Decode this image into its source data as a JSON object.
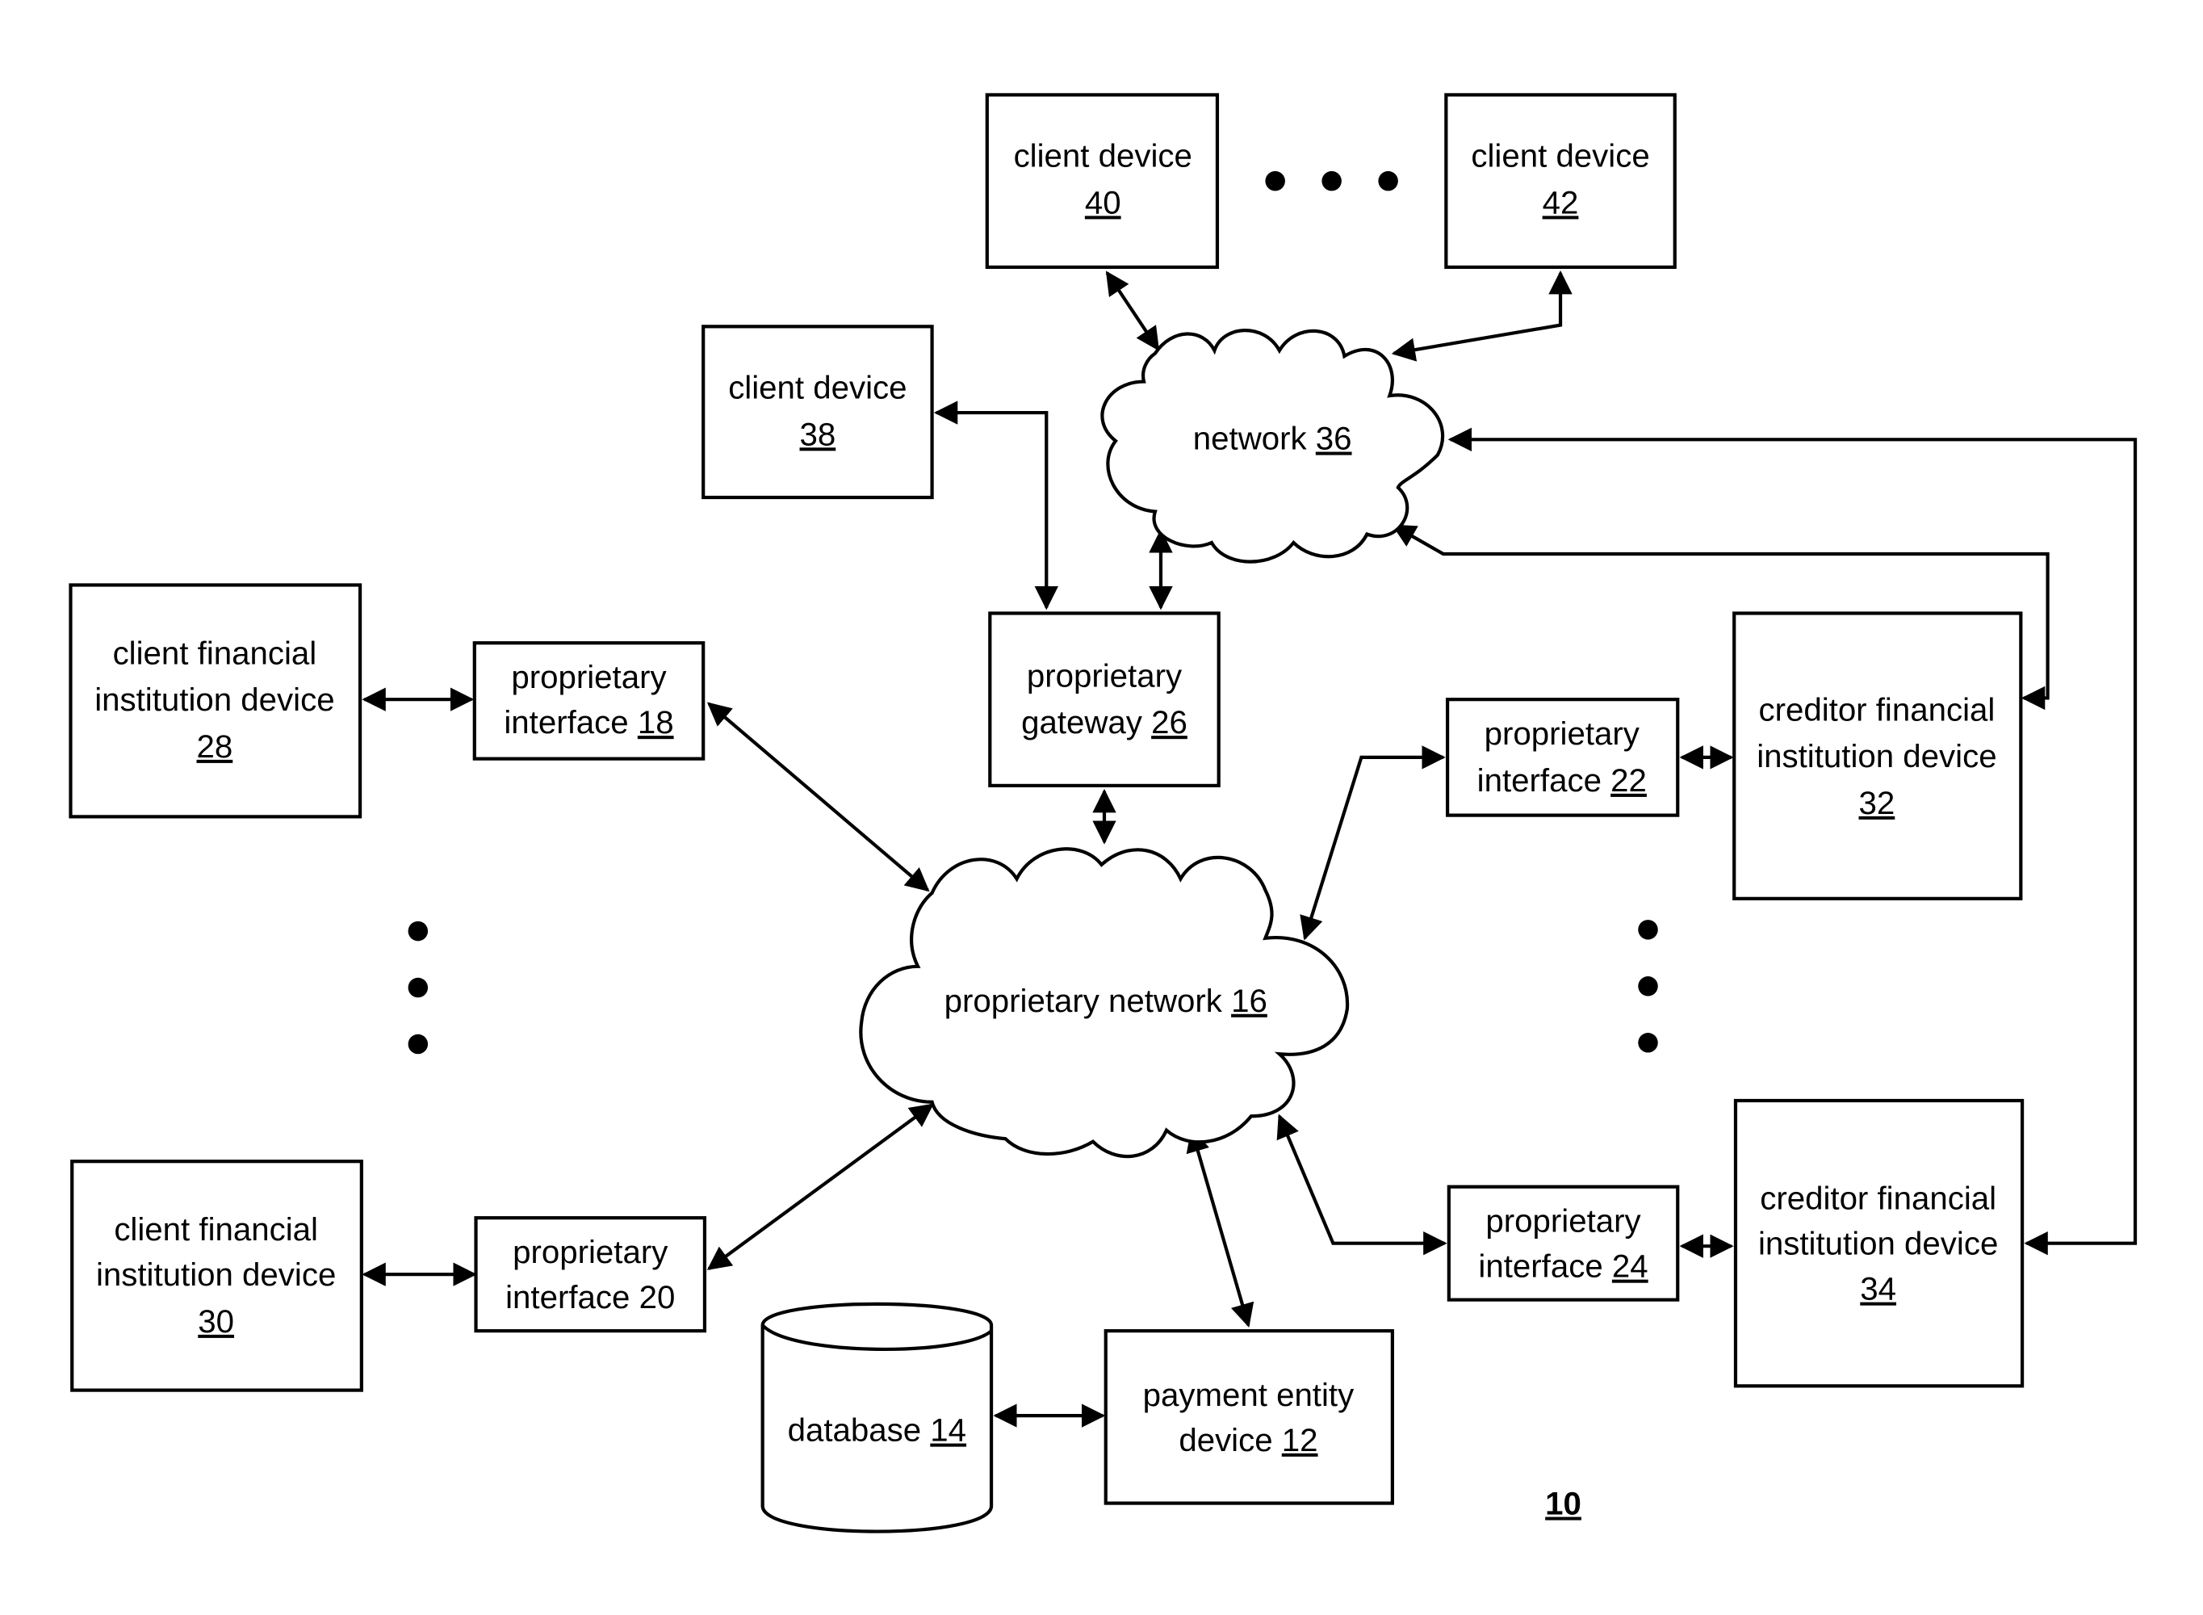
{
  "figure": {
    "reference": "10",
    "nodes": {
      "client_device_40": {
        "line1": "client device",
        "num": "40"
      },
      "client_device_42": {
        "line1": "client device",
        "num": "42"
      },
      "client_device_38": {
        "line1": "client device",
        "num": "38"
      },
      "network_36": {
        "line1": "network",
        "num": "36"
      },
      "proprietary_gateway_26": {
        "line1": "proprietary",
        "line2": "gateway",
        "num": "26"
      },
      "client_fi_28": {
        "line1": "client financial",
        "line2": "institution device",
        "num": "28"
      },
      "client_fi_30": {
        "line1": "client financial",
        "line2": "institution device",
        "num": "30"
      },
      "proprietary_interface_18": {
        "line1": "proprietary",
        "line2": "interface",
        "num": "18"
      },
      "proprietary_interface_20": {
        "line1": "proprietary",
        "line2": "interface",
        "num": "20"
      },
      "proprietary_interface_22": {
        "line1": "proprietary",
        "line2": "interface",
        "num": "22"
      },
      "proprietary_interface_24": {
        "line1": "proprietary",
        "line2": "interface",
        "num": "24"
      },
      "creditor_fi_32": {
        "line1": "creditor financial",
        "line2": "institution device",
        "num": "32"
      },
      "creditor_fi_34": {
        "line1": "creditor financial",
        "line2": "institution device",
        "num": "34"
      },
      "proprietary_network_16": {
        "line1": "proprietary network",
        "num": "16"
      },
      "database_14": {
        "line1": "database",
        "num": "14"
      },
      "payment_entity_12": {
        "line1": "payment entity",
        "line2": "device",
        "num": "12"
      }
    }
  }
}
